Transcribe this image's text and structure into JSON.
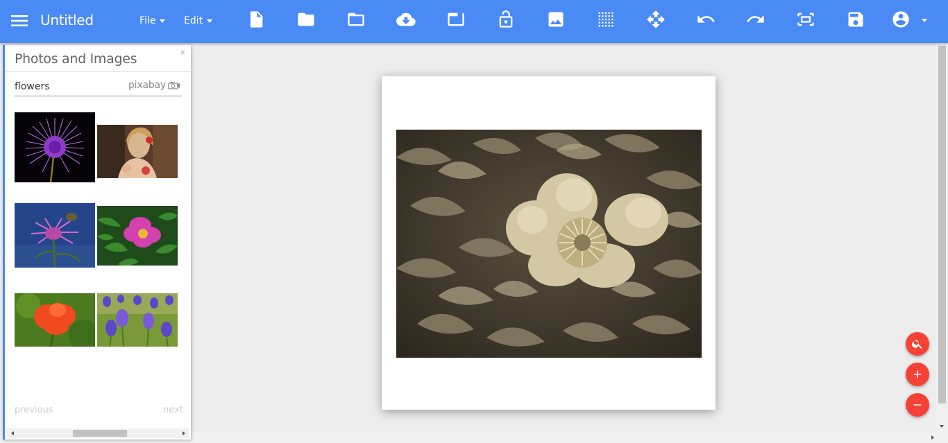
{
  "header": {
    "title": "Untitled",
    "menus": [
      {
        "label": "File"
      },
      {
        "label": "Edit"
      }
    ],
    "toolbar_icons": [
      "new-document-icon",
      "folder-icon",
      "folder-open-icon",
      "cloud-download-icon",
      "window-icon",
      "lock-open-icon",
      "image-icon",
      "grid-icon",
      "move-icon",
      "undo-icon",
      "redo-icon",
      "fit-screen-icon",
      "save-icon",
      "account-icon"
    ]
  },
  "panel": {
    "title": "Photos and Images",
    "close_label": "×",
    "search": {
      "value": "flowers"
    },
    "provider": "pixabay",
    "thumbnails": [
      "purple-thistle-flower",
      "woman-with-red-flower",
      "pink-cornflower-bee",
      "pink-peony-leaves",
      "orange-poppy",
      "purple-iris-field"
    ],
    "previous_label": "previous",
    "next_label": "next"
  },
  "canvas": {
    "photo": "sepia-peony-flower"
  },
  "fabs": [
    "search-icon",
    "zoom-in-icon",
    "zoom-out-icon"
  ],
  "colors": {
    "toolbar": "#4a8af4",
    "fab": "#f44336",
    "panel_accent": "#4a8af4"
  }
}
